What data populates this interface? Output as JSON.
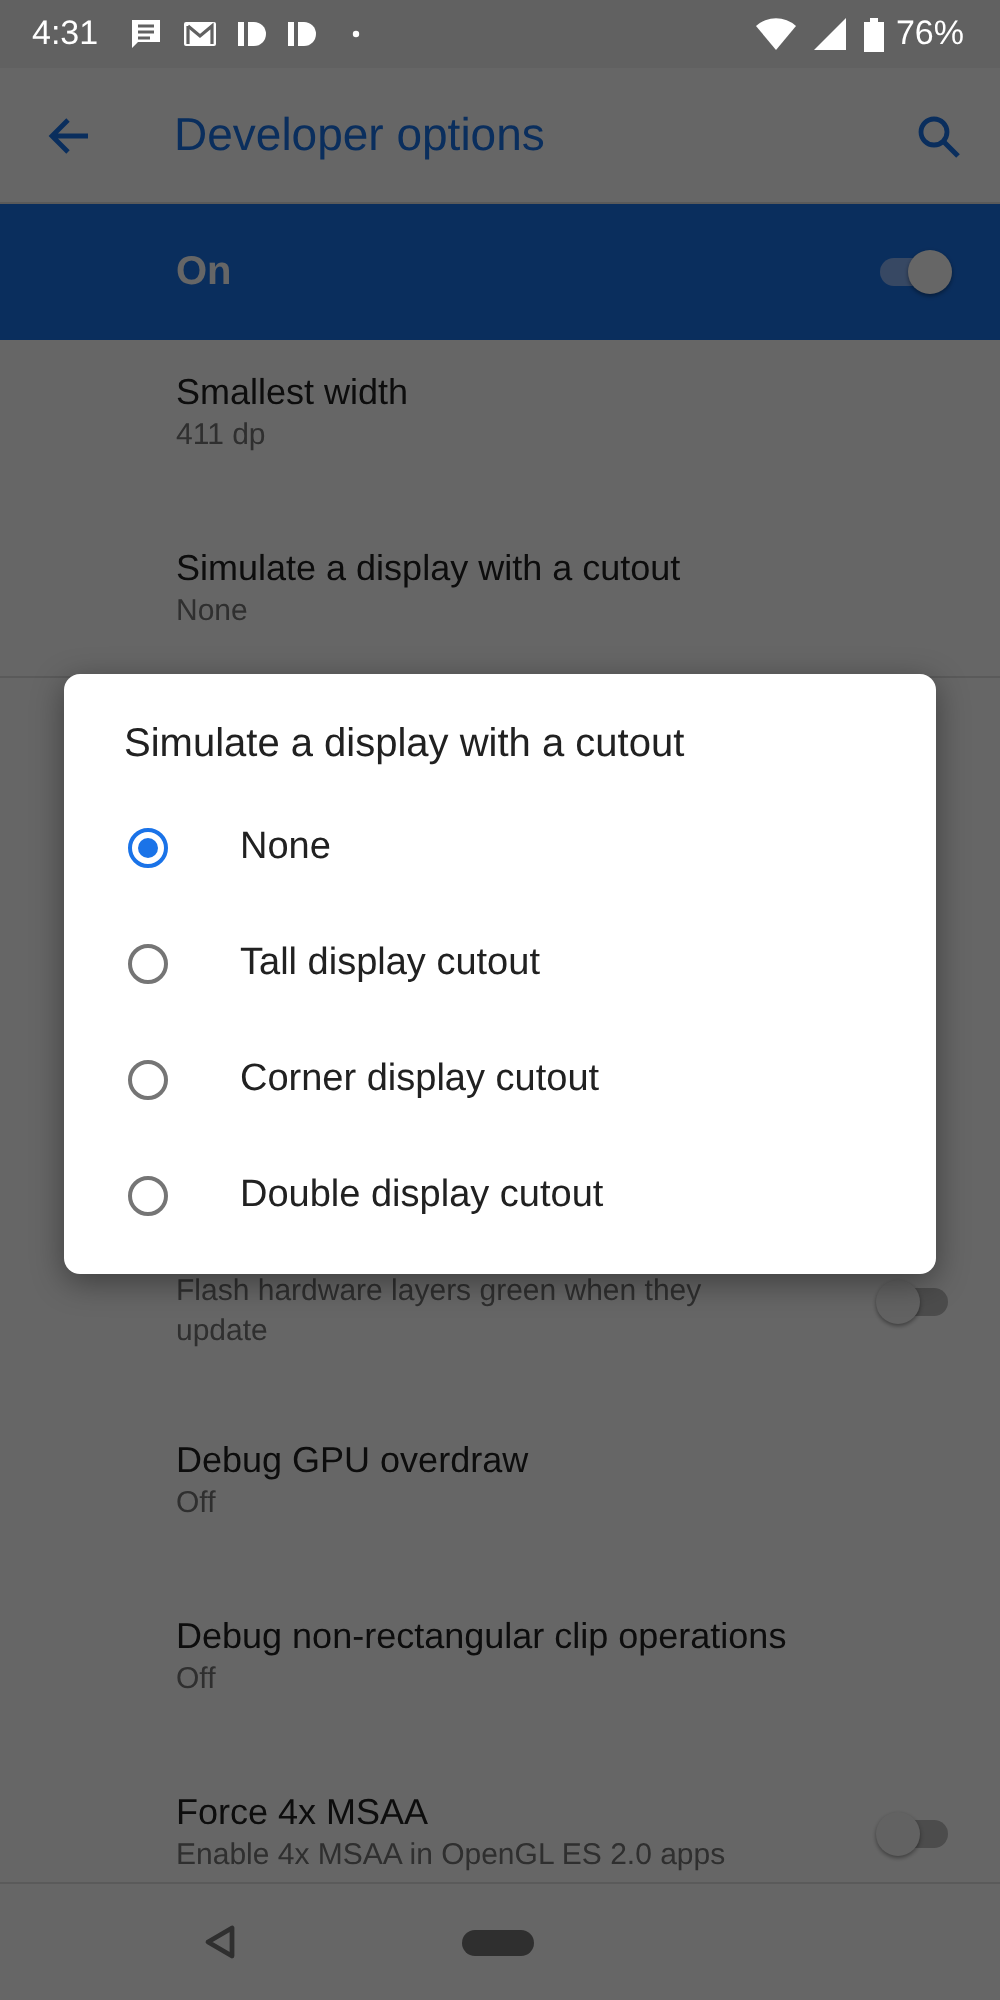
{
  "status_bar": {
    "time": "4:31",
    "battery": "76%"
  },
  "app_bar": {
    "title": "Developer options"
  },
  "master_switch": {
    "label": "On",
    "on": true
  },
  "settings": [
    {
      "kind": "plain",
      "title": "Smallest width",
      "summary": "411 dp"
    },
    {
      "kind": "plain",
      "title": "Simulate a display with a cutout",
      "summary": "None"
    },
    {
      "kind": "gap"
    },
    {
      "kind": "switch",
      "summary": "Flash hardware layers green when they update",
      "on": false
    },
    {
      "kind": "plain",
      "title": "Debug GPU overdraw",
      "summary": "Off"
    },
    {
      "kind": "plain",
      "title": "Debug non-rectangular clip operations",
      "summary": "Off"
    },
    {
      "kind": "switch",
      "title": "Force 4x MSAA",
      "summary": "Enable 4x MSAA in OpenGL ES 2.0 apps",
      "on": false
    }
  ],
  "dialog": {
    "title": "Simulate a display with a cutout",
    "options": [
      {
        "label": "None",
        "selected": true
      },
      {
        "label": "Tall display cutout",
        "selected": false
      },
      {
        "label": "Corner display cutout",
        "selected": false
      },
      {
        "label": "Double display cutout",
        "selected": false
      }
    ]
  }
}
